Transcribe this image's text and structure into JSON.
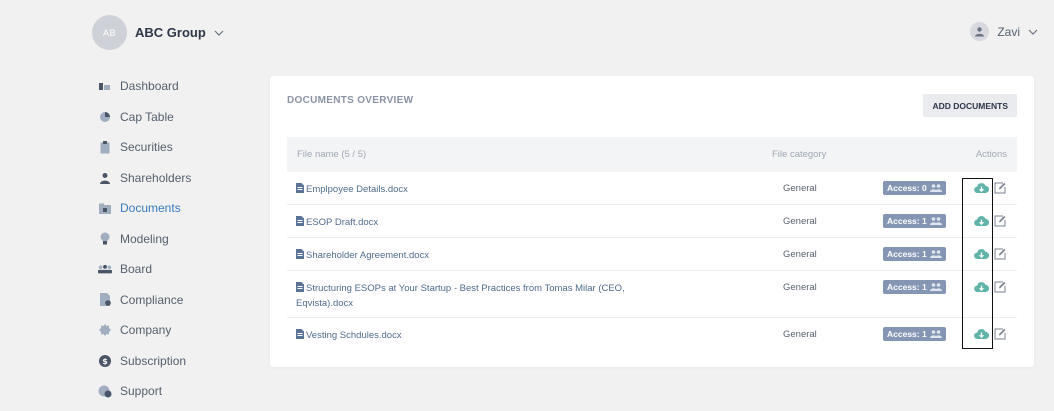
{
  "org": {
    "initials": "AB",
    "name": "ABC Group"
  },
  "user": {
    "name": "Zavi"
  },
  "sidebar": {
    "items": [
      {
        "label": "Dashboard",
        "icon": "dashboard-icon"
      },
      {
        "label": "Cap Table",
        "icon": "pie-chart-icon"
      },
      {
        "label": "Securities",
        "icon": "clipboard-icon"
      },
      {
        "label": "Shareholders",
        "icon": "person-icon"
      },
      {
        "label": "Documents",
        "icon": "folder-icon",
        "active": true
      },
      {
        "label": "Modeling",
        "icon": "lightbulb-icon"
      },
      {
        "label": "Board",
        "icon": "group-icon"
      },
      {
        "label": "Compliance",
        "icon": "file-check-icon"
      },
      {
        "label": "Company",
        "icon": "badge-icon"
      },
      {
        "label": "Subscription",
        "icon": "dollar-icon"
      },
      {
        "label": "Support",
        "icon": "support-icon"
      }
    ]
  },
  "documents": {
    "title": "DOCUMENTS OVERVIEW",
    "add_label": "ADD DOCUMENTS",
    "headers": {
      "file_name": "File name (5 / 5)",
      "category": "File category",
      "actions": "Actions"
    },
    "rows": [
      {
        "name": "Emplpoyee Details.docx",
        "category": "General",
        "access": "Access: 0"
      },
      {
        "name": "ESOP Draft.docx",
        "category": "General",
        "access": "Access: 1"
      },
      {
        "name": "Shareholder Agreement.docx",
        "category": "General",
        "access": "Access: 1"
      },
      {
        "name": "Structuring ESOPs at Your Startup - Best Practices from Tomas Milar (CEO, Eqvista).docx",
        "category": "General",
        "access": "Access: 1"
      },
      {
        "name": "Vesting Schdules.docx",
        "category": "General",
        "access": "Access: 1"
      }
    ]
  },
  "colors": {
    "accent": "#3b7bbf",
    "badge": "#8496b4",
    "download": "#5fb3a8"
  }
}
